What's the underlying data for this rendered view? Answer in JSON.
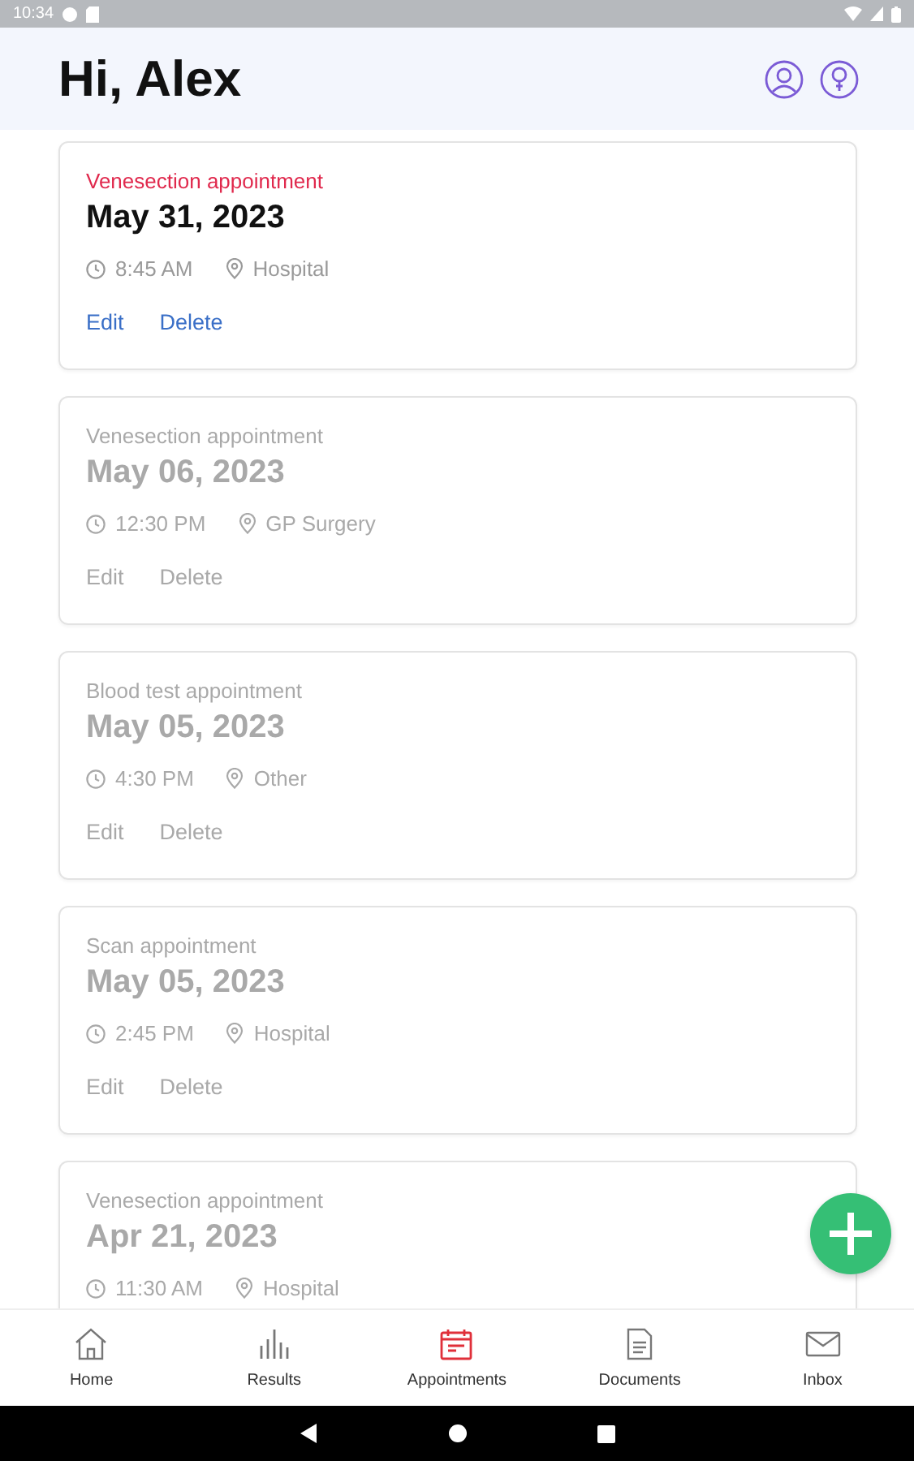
{
  "status_bar": {
    "time": "10:34"
  },
  "header": {
    "greeting": "Hi, Alex"
  },
  "appointments": [
    {
      "type": "Venesection appointment",
      "date": "May 31, 2023",
      "time": "8:45 AM",
      "location": "Hospital",
      "active": true,
      "actions": [
        "Edit",
        "Delete"
      ]
    },
    {
      "type": "Venesection appointment",
      "date": "May 06, 2023",
      "time": "12:30 PM",
      "location": "GP Surgery",
      "active": false,
      "actions": [
        "Edit",
        "Delete"
      ]
    },
    {
      "type": "Blood test appointment",
      "date": "May 05, 2023",
      "time": "4:30 PM",
      "location": "Other",
      "active": false,
      "actions": [
        "Edit",
        "Delete"
      ]
    },
    {
      "type": "Scan appointment",
      "date": "May 05, 2023",
      "time": "2:45 PM",
      "location": "Hospital",
      "active": false,
      "actions": [
        "Edit",
        "Delete"
      ]
    },
    {
      "type": "Venesection appointment",
      "date": "Apr 21, 2023",
      "time": "11:30 AM",
      "location": "Hospital",
      "active": false
    }
  ],
  "nav": [
    {
      "kind": "home",
      "label": "Home",
      "selected": false
    },
    {
      "kind": "results",
      "label": "Results",
      "selected": false
    },
    {
      "kind": "appointments",
      "label": "Appointments",
      "selected": true
    },
    {
      "kind": "documents",
      "label": "Documents",
      "selected": false
    },
    {
      "kind": "inbox",
      "label": "Inbox",
      "selected": false
    }
  ]
}
